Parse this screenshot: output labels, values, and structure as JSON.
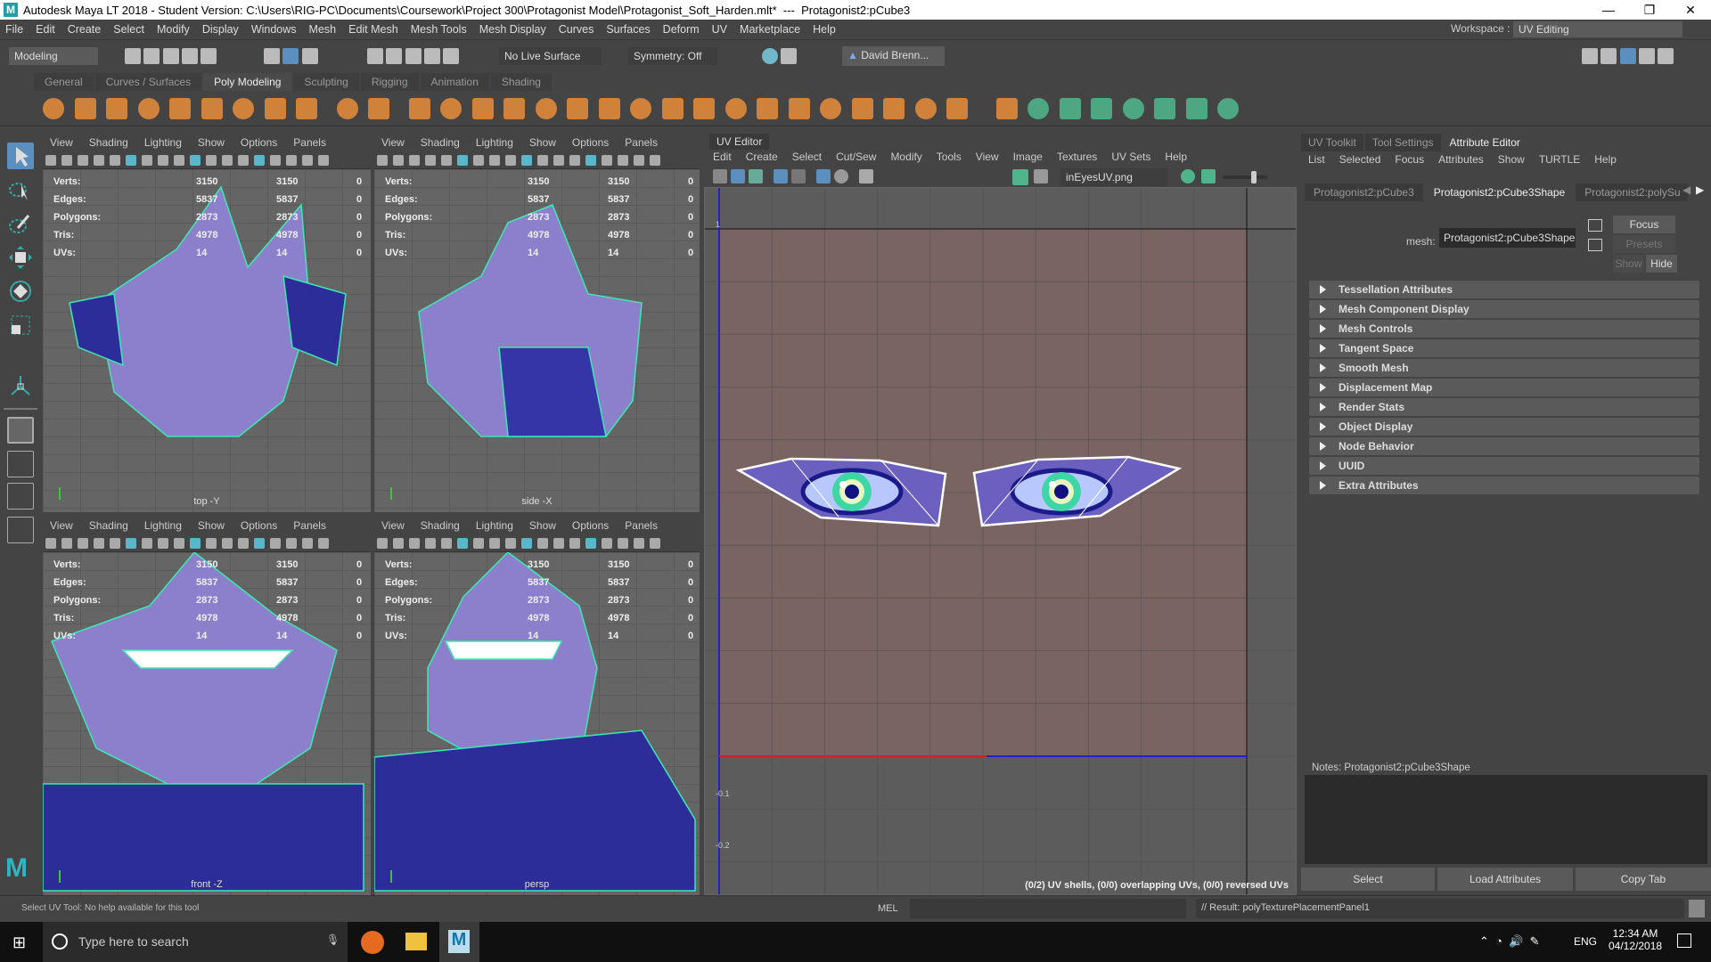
{
  "title": {
    "text": "Autodesk Maya LT 2018 - Student Version: C:\\Users\\RIG-PC\\Documents\\Coursework\\Project 300\\Protagonist Model\\Protagonist_Soft_Harden.mlt*  ---  Protagonist2:pCube3",
    "minimize": "—",
    "maximize": "❐",
    "close": "✕"
  },
  "menubar": [
    "File",
    "Edit",
    "Create",
    "Select",
    "Modify",
    "Display",
    "Windows",
    "Mesh",
    "Edit Mesh",
    "Mesh Tools",
    "Mesh Display",
    "Curves",
    "Surfaces",
    "Deform",
    "UV",
    "Marketplace",
    "Help"
  ],
  "workspace": {
    "label": "Workspace :",
    "value": "UV Editing"
  },
  "statusline": {
    "mode": "Modeling",
    "live_surface": "No Live Surface",
    "symmetry": "Symmetry: Off",
    "user": "David Brenn..."
  },
  "shelf": {
    "tabs": [
      "General",
      "Curves / Surfaces",
      "Poly Modeling",
      "Sculpting",
      "Rigging",
      "Animation",
      "Shading"
    ],
    "active": 2,
    "orange": "#e0893a",
    "green": "#4fb38b"
  },
  "viewport_menu": [
    "View",
    "Shading",
    "Lighting",
    "Show",
    "Options",
    "Panels"
  ],
  "hud": [
    [
      "Verts:",
      "3150",
      "3150",
      "0"
    ],
    [
      "Edges:",
      "5837",
      "5837",
      "0"
    ],
    [
      "Polygons:",
      "2873",
      "2873",
      "0"
    ],
    [
      "Tris:",
      "4978",
      "4978",
      "0"
    ],
    [
      "UVs:",
      "14",
      "14",
      "0"
    ]
  ],
  "viewports": [
    {
      "label": "top -Y"
    },
    {
      "label": "side -X"
    },
    {
      "label": "front -Z"
    },
    {
      "label": "persp"
    }
  ],
  "uv_editor": {
    "tab": "UV Editor",
    "menu": [
      "Edit",
      "Create",
      "Select",
      "Cut/Sew",
      "Modify",
      "Tools",
      "View",
      "Image",
      "Textures",
      "UV Sets",
      "Help"
    ],
    "image": "inEyesUV.png",
    "axis_top": "1",
    "axis_neg1": "-0.1",
    "axis_neg2": "-0.2",
    "status": "(0/2) UV shells, (0/0) overlapping UVs, (0/0) reversed UVs"
  },
  "attr": {
    "tabs": [
      "UV Toolkit",
      "Tool Settings",
      "Attribute Editor"
    ],
    "menu": [
      "List",
      "Selected",
      "Focus",
      "Attributes",
      "Show",
      "TURTLE",
      "Help"
    ],
    "node_tabs": [
      "Protagonist2:pCube3",
      "Protagonist2:pCube3Shape",
      "Protagonist2:polySu"
    ],
    "mesh_label": "mesh:",
    "mesh_value": "Protagonist2:pCube3Shape",
    "focus": "Focus",
    "presets": "Presets",
    "show": "Show",
    "hide": "Hide",
    "sections": [
      "Tessellation Attributes",
      "Mesh Component Display",
      "Mesh Controls",
      "Tangent Space",
      "Smooth Mesh",
      "Displacement Map",
      "Render Stats",
      "Object Display",
      "Node Behavior",
      "UUID",
      "Extra Attributes"
    ],
    "notes": "Notes:  Protagonist2:pCube3Shape",
    "select": "Select",
    "load": "Load Attributes",
    "copy": "Copy Tab"
  },
  "cmdline": {
    "help": "Select UV Tool: No help available for this tool",
    "lang": "MEL",
    "result": "// Result: polyTexturePlacementPanel1"
  },
  "taskbar": {
    "search": "Type here to search",
    "lang": "ENG",
    "time": "12:34 AM",
    "date": "04/12/2018"
  }
}
